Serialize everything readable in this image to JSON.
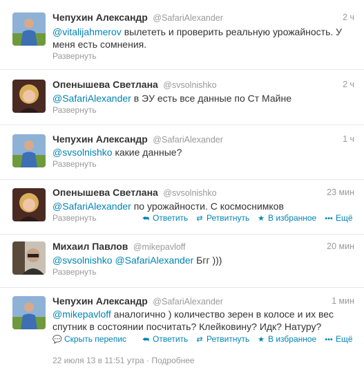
{
  "tweets": [
    {
      "name": "Чепухин Александр",
      "handle": "@SafariAlexander",
      "time": "2 ч",
      "mention": "@vitalijahmerov",
      "text": " вылететь и проверить реальную урожайность. У меня есть сомнения.",
      "expand": "Развернуть"
    },
    {
      "name": "Опенышева Светлана",
      "handle": "@svsolnishko",
      "time": "2 ч",
      "mention": "@SafariAlexander",
      "text": " в ЭУ есть все данные по Ст Майне",
      "expand": "Развернуть"
    },
    {
      "name": "Чепухин Александр",
      "handle": "@SafariAlexander",
      "time": "1 ч",
      "mention": "@svsolnishko",
      "text": " какие данные?",
      "expand": "Развернуть"
    },
    {
      "name": "Опенышева Светлана",
      "handle": "@svsolnishko",
      "time": "23 мин",
      "mention": "@SafariAlexander",
      "text": " по урожайности. С космоснимков",
      "expand": "Развернуть",
      "reply": "Ответить",
      "retweet": "Ретвитнуть",
      "favorite": "В избранное",
      "more": "Ещё"
    },
    {
      "name": "Михаил Павлов",
      "handle": "@mikepavloff",
      "time": "20 мин",
      "mention": "@svsolnishko",
      "mention2": "@SafariAlexander",
      "text": " Бгг )))",
      "expand": "Развернуть"
    },
    {
      "name": "Чепухин Александр",
      "handle": "@SafariAlexander",
      "time": "1 мин",
      "mention": "@mikepavloff",
      "text": " аналогично ) количество зерен в колосе и их вес спутник в состоянии посчитать? Клейковину? Идк? Натуру?",
      "hide": "Скрыть перепис",
      "reply": "Ответить",
      "retweet": "Ретвитнуть",
      "favorite": "В избранное",
      "more": "Ещё",
      "timestamp": "22 июля 13 в 11:51 утра",
      "dot": " · ",
      "details": "Подробнее"
    }
  ],
  "colors": {
    "link": "#0084b4",
    "muted": "#999999",
    "divider": "#e8e8e8"
  },
  "icons": {
    "reply": "reply-arrow-icon",
    "retweet": "retweet-arrows-icon",
    "favorite": "star-icon",
    "more": "ellipsis-icon",
    "hide": "speech-bubble-icon"
  }
}
